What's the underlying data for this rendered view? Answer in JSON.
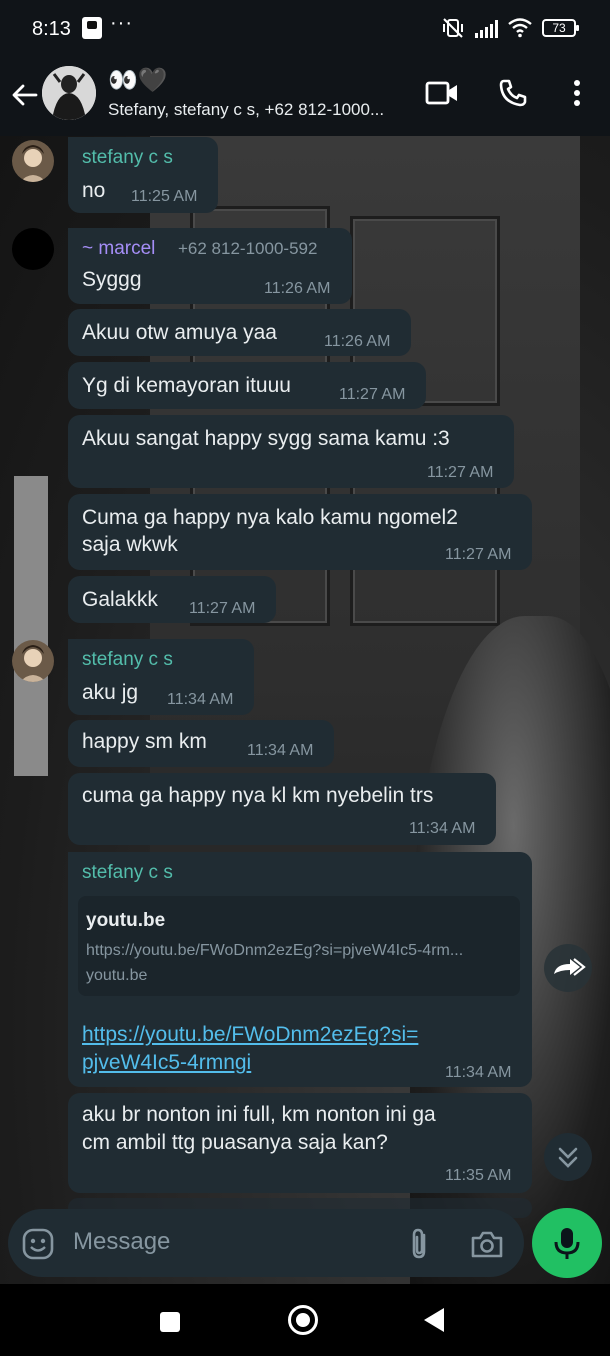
{
  "status_bar": {
    "time": "8:13",
    "more": "···",
    "battery": "73"
  },
  "header": {
    "title": "👀🖤",
    "subtitle": "Stefany, stefany c s, +62 812-1000..."
  },
  "colors": {
    "sender_stefany": "#53bdab",
    "sender_marcel": "#a58ef7",
    "link": "#53bdeb",
    "mic": "#21c063"
  },
  "messages": [
    {
      "sender": "stefany c s",
      "lines": [
        "no"
      ],
      "time": "11:25 AM"
    },
    {
      "sender": "~ marcel",
      "phone": "+62 812-1000-592",
      "lines": [
        "Syggg"
      ],
      "time": "11:26 AM"
    },
    {
      "lines": [
        "Akuu otw amuya yaa"
      ],
      "time": "11:26 AM"
    },
    {
      "lines": [
        "Yg di kemayoran ituuu"
      ],
      "time": "11:27 AM"
    },
    {
      "lines": [
        "Akuu sangat happy sygg sama kamu :3"
      ],
      "time": "11:27 AM"
    },
    {
      "lines": [
        "Cuma ga happy nya kalo kamu ngomel2",
        "saja wkwk"
      ],
      "time": "11:27 AM"
    },
    {
      "lines": [
        "Galakkk"
      ],
      "time": "11:27 AM"
    },
    {
      "sender": "stefany c s",
      "lines": [
        "aku jg"
      ],
      "time": "11:34 AM"
    },
    {
      "lines": [
        "happy sm km"
      ],
      "time": "11:34 AM"
    },
    {
      "lines": [
        "cuma ga happy nya kl km nyebelin trs"
      ],
      "time": "11:34 AM"
    },
    {
      "sender": "stefany c s",
      "preview": {
        "title": "youtu.be",
        "url": "https://youtu.be/FWoDnm2ezEg?si=pjveW4Ic5-4rm...",
        "domain": "youtu.be"
      },
      "link_lines": [
        "https://youtu.be/FWoDnm2ezEg?si=",
        "pjveW4Ic5-4rmngi"
      ],
      "time": "11:34 AM"
    },
    {
      "lines": [
        "aku br nonton ini full, km nonton ini ga",
        "cm ambil ttg puasanya saja kan?"
      ],
      "time": "11:35 AM"
    }
  ],
  "input": {
    "placeholder": "Message"
  },
  "icons": [
    "back-arrow-icon",
    "video-call-icon",
    "phone-icon",
    "more-vert-icon",
    "forward-icon",
    "chevron-down-icon",
    "emoji-icon",
    "attach-icon",
    "camera-icon",
    "mic-icon"
  ]
}
